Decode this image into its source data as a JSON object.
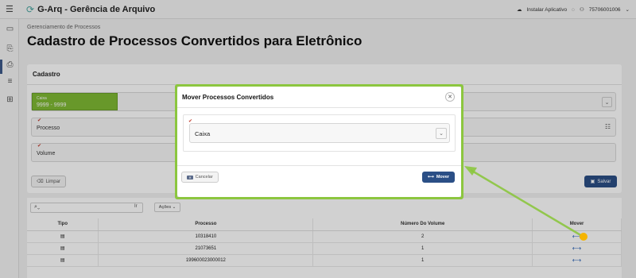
{
  "topbar": {
    "menu_icon": "hamburger-icon",
    "logo_icon": "g-arq-logo-icon",
    "title": "G-Arq - Gerência de Arquivo",
    "install_label": "Instalar Aplicativo",
    "user_label": "75706001006"
  },
  "sidebar": {
    "icons": [
      "folder-icon",
      "document-move-icon",
      "document-add-icon",
      "list-icon",
      "book-icon"
    ]
  },
  "breadcrumb": "Gerenciamento de Processos",
  "page_title": "Cadastro de Processos Convertidos para Eletrônico",
  "form": {
    "card_title": "Cadastro",
    "caixa_label": "Caixa",
    "caixa_value": "9999 - 9999",
    "processo_label": "Processo",
    "volume_label": "Volume",
    "limpar_label": "Limpar",
    "salvar_label": "Salvar"
  },
  "grid": {
    "go_label": "Ir",
    "actions_label": "Ações",
    "columns": [
      "Tipo",
      "Processo",
      "Número Do Volume",
      "Mover"
    ],
    "rows": [
      {
        "processo": "10318410",
        "volume": "2"
      },
      {
        "processo": "21073651",
        "volume": "1"
      },
      {
        "processo": "199600023000012",
        "volume": "1"
      }
    ]
  },
  "modal": {
    "title": "Mover Processos Convertidos",
    "select_value": "Caixa",
    "cancel_label": "Cancelar",
    "mover_label": "Mover"
  },
  "colors": {
    "primary": "#2b4f86",
    "highlight": "#8cc63f",
    "caixa_green": "#7fba34"
  }
}
